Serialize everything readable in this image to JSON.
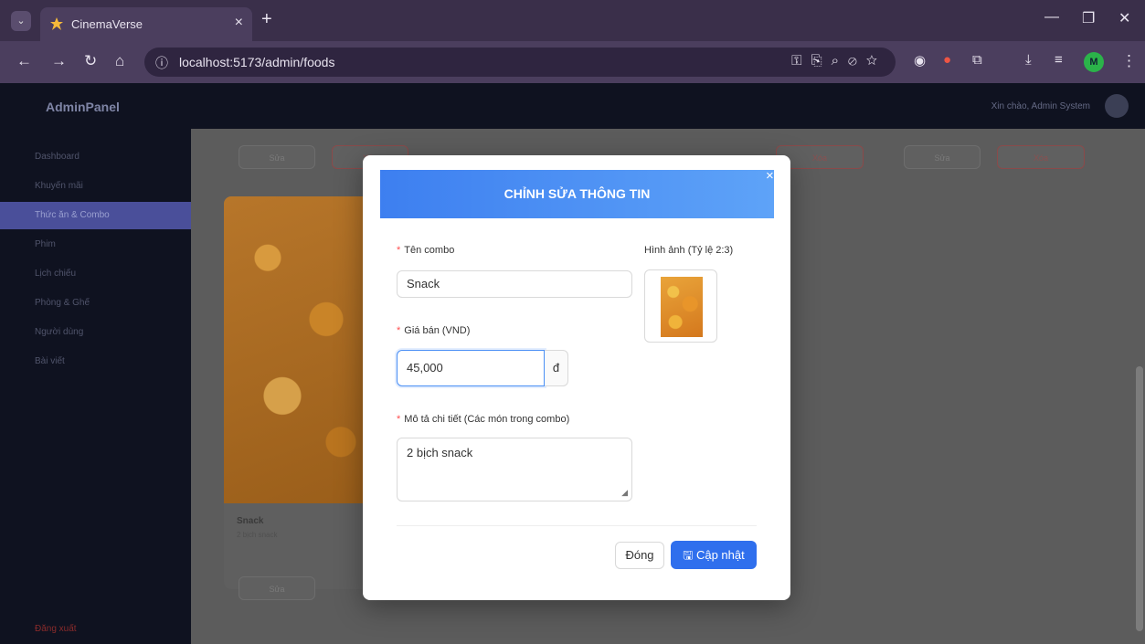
{
  "browser": {
    "tab_title": "CinemaVerse",
    "url": "localhost:5173/admin/foods",
    "profile_initial": "M"
  },
  "app": {
    "logo": "AdminPanel",
    "user_greeting": "Xin chào, Admin System",
    "sidebar": [
      {
        "label": "Dashboard"
      },
      {
        "label": "Khuyến mãi"
      },
      {
        "label": "Thức ăn & Combo"
      },
      {
        "label": "Phim"
      },
      {
        "label": "Lịch chiếu"
      },
      {
        "label": "Phòng & Ghế"
      },
      {
        "label": "Người dùng"
      },
      {
        "label": "Bài viết"
      }
    ],
    "logout": "Đăng xuất",
    "card": {
      "name": "Snack",
      "desc": "2 bịch snack",
      "edit": "Sửa",
      "delete": "Xóa"
    }
  },
  "modal": {
    "title": "CHỈNH SỬA THÔNG TIN",
    "name_label": "Tên combo",
    "name_value": "Snack",
    "image_label": "Hình ảnh (Tỷ lệ 2:3)",
    "price_label": "Giá bán (VND)",
    "price_value": "45,000",
    "currency": "đ",
    "desc_label": "Mô tả chi tiết (Các món trong combo)",
    "desc_value": "2 bịch snack",
    "close_button": "Đóng",
    "update_button": "Cập nhật"
  },
  "colors": {
    "header_gradient_start": "#3d7ff0",
    "header_gradient_end": "#5ea3f8",
    "primary": "#2f6fed",
    "required": "#ff4d4f"
  }
}
